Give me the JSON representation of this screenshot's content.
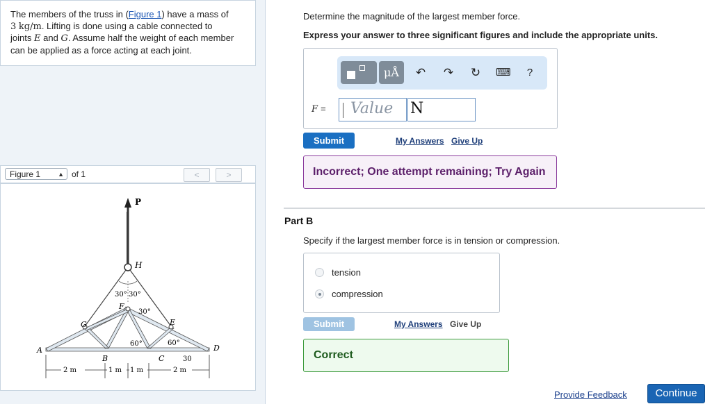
{
  "problem": {
    "line1_pre": "The members of the truss in (",
    "figure_link": "Figure 1",
    "line1_post": ") have a mass of",
    "mass_value": "3",
    "mass_unit": "kg/m",
    "line2_post": ". Lifting is done using a cable connected to",
    "line3_pre": "joints",
    "joint_e": "E",
    "line3_mid": "and",
    "joint_g": "G",
    "line3_post": ". Assume half the weight of each member",
    "line4": "can be applied as a force acting at each joint."
  },
  "figure_nav": {
    "select_value": "Figure 1",
    "of_text": "of 1",
    "prev": "<",
    "next": ">"
  },
  "figure": {
    "labels": {
      "P": "P",
      "H": "H",
      "F": "F",
      "G": "G",
      "E": "E",
      "A": "A",
      "B": "B",
      "C": "C",
      "D": "D",
      "angle_30_left": "30°",
      "angle_30_right": "30°",
      "angle_30_f": "30°",
      "angle_60_left": "60°",
      "angle_60_right": "60°",
      "angle_30_bottom": "30"
    },
    "dimensions": [
      "2 m",
      "1 m",
      "1 m",
      "2 m"
    ]
  },
  "part_a": {
    "question": "Determine the magnitude of the largest member force.",
    "instruction": "Express your answer to three significant figures and include the appropriate units.",
    "toolbar": {
      "units_label": "μÅ",
      "undo_icon": "↶",
      "redo_icon": "↷",
      "reset_icon": "↻",
      "keyboard_icon": "⌨",
      "help_label": "?"
    },
    "variable_label": "F",
    "equals": "=",
    "value_placeholder": "Value",
    "unit_value": "N",
    "submit_label": "Submit",
    "my_answers_label": "My Answers",
    "give_up_label": "Give Up",
    "feedback": "Incorrect; One attempt remaining; Try Again",
    "colors": {
      "submit": "#1a6fc2",
      "feedback_border": "#8a3a9c"
    }
  },
  "part_b": {
    "title": "Part B",
    "question": "Specify if the largest member force is in tension or compression.",
    "options": [
      {
        "label": "tension",
        "selected": false
      },
      {
        "label": "compression",
        "selected": true
      }
    ],
    "submit_label": "Submit",
    "my_answers_label": "My Answers",
    "give_up_label": "Give Up",
    "feedback": "Correct",
    "colors": {
      "submit_disabled": "#9fc3e2",
      "feedback_border": "#3c9a3c"
    }
  },
  "footer": {
    "provide_feedback": "Provide Feedback",
    "continue": "Continue"
  }
}
